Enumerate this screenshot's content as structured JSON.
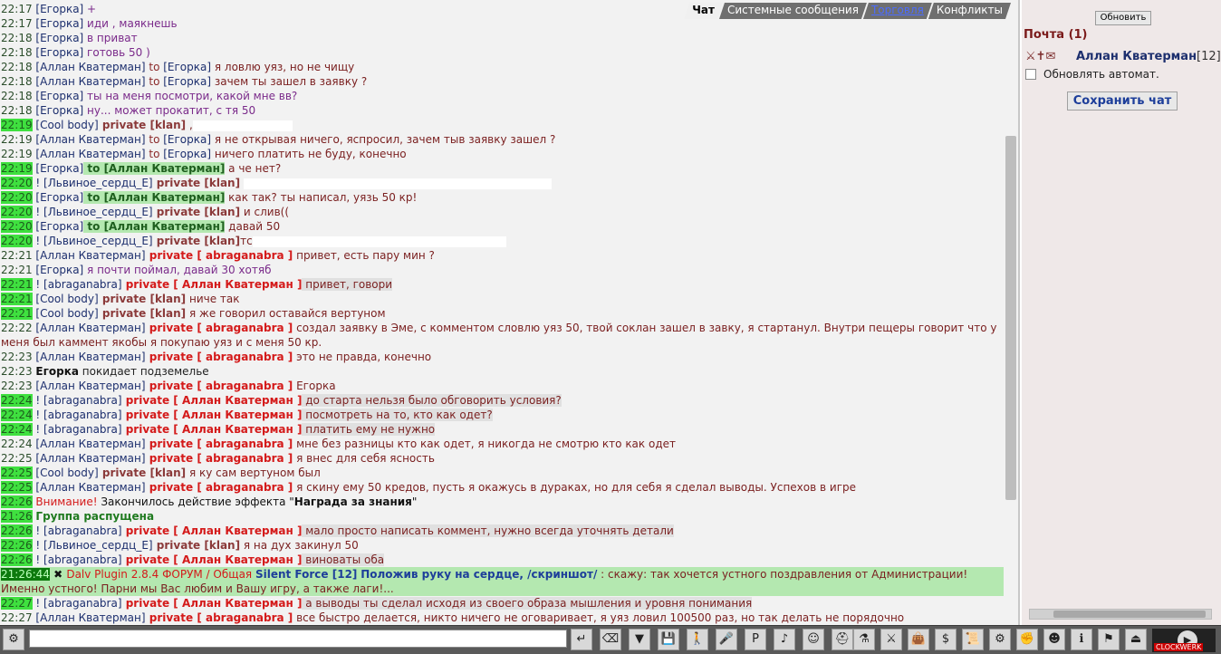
{
  "tabs": [
    {
      "label": "Чат"
    },
    {
      "label": "Системные сообщения"
    },
    {
      "label": "Торговля"
    },
    {
      "label": "Конфликты"
    }
  ],
  "sidebar": {
    "refresh_label": "Обновить",
    "mail_title": "Почта (1)",
    "mail_user": "Аллан Кватерман",
    "mail_level": "[12]",
    "auto_refresh_label": "Обновлять автомат.",
    "save_chat_label": "Сохранить чат"
  },
  "messages": [
    {
      "ts": "22:17",
      "nick": "[Егорка]",
      "text": " +",
      "style": "purple"
    },
    {
      "ts": "22:17",
      "nick": "[Егорка]",
      "text": " иди , маякнешь",
      "style": "purple"
    },
    {
      "ts": "22:18",
      "nick": "[Егорка]",
      "text": " в приват",
      "style": "purple"
    },
    {
      "ts": "22:18",
      "nick": "[Егорка]",
      "text": " готовь 50 )",
      "style": "purple"
    },
    {
      "ts": "22:18",
      "nick": "[Аллан Кватерман]",
      "to": " to ",
      "tonick": "[Егорка]",
      "text": " я ловлю уяз, но не чищу"
    },
    {
      "ts": "22:18",
      "nick": "[Аллан Кватерман]",
      "to": " to ",
      "tonick": "[Егорка]",
      "text": " зачем ты зашел в заявку ?"
    },
    {
      "ts": "22:18",
      "nick": "[Егорка]",
      "text": " ты на меня посмотри, какой мне вв?",
      "style": "purple"
    },
    {
      "ts": "22:18",
      "nick": "[Егорка]",
      "text": " ну... может прокатит, с тя 50",
      "style": "purple"
    }
  ],
  "messages2": [
    {
      "ts": "22:19",
      "nick": "[Cool body]",
      "priv": " private [klan]",
      "text": " ,"
    },
    {
      "ts": "22:19",
      "nick": "[Аллан Кватерман]",
      "to": " to ",
      "tonick": "[Егорка]",
      "text": " я не открывая ничего, яспросил, зачем тыв заявку зашел ?"
    },
    {
      "ts": "22:19",
      "nick": "[Аллан Кватерман]",
      "to": " to ",
      "tonick": "[Егорка]",
      "text": " ничего платить не буду, конечно"
    },
    {
      "ts": "22:19",
      "nick": "[Егорка]",
      "togreen": " to [Аллан Кватерман]",
      "text": " а че нет?"
    },
    {
      "ts": "22:20",
      "nick": "! [Львиное_сердц_Е]",
      "priv": " private [klan]",
      "text": " "
    },
    {
      "ts": "22:20",
      "nick": "[Егорка]",
      "togreen": " to [Аллан Кватерман]",
      "text": " как так? ты написал, уязь 50 кр!"
    },
    {
      "ts": "22:20",
      "nick": "! [Львиное_сердц_Е]",
      "priv": " private [klan]",
      "text": " и слив(("
    },
    {
      "ts": "22:20",
      "nick": "[Егорка]",
      "togreen": " to [Аллан Кватерман]",
      "text": " давай 50"
    },
    {
      "ts": "22:20",
      "nick": "! [Львиное_сердц_Е]",
      "priv": " private [klan]",
      "text": "тс"
    },
    {
      "ts": "22:21",
      "nick": "[Аллан Кватерман]",
      "privred": " private [ abraganabra ]",
      "text": " привет, есть пару мин ?"
    },
    {
      "ts": "22:21",
      "nick": "[Егорка]",
      "text": " я почти поймал, давай 30 хотяб",
      "style": "purple"
    },
    {
      "ts": "22:21",
      "nick": "! [abraganabra]",
      "privred": " private [ Аллан Кватерман ]",
      "text": " привет, говори"
    },
    {
      "ts": "22:21",
      "nick": "[Cool body]",
      "priv": " private [klan]",
      "text": " ниче так"
    },
    {
      "ts": "22:21",
      "nick": "[Cool body]",
      "priv": " private [klan]",
      "text": " я же говорил оставайся вертуном"
    }
  ],
  "long_msg": {
    "ts": "22:22",
    "nick": "[Аллан Кватерман]",
    "priv": " private [ abraganabra ]",
    "text": " создал заявку в Эме, с комментом словлю уяз 50, твой соклан зашел в завку, я стартанул. Внутри пещеры говорит что у меня был каммент якобы я покупаю уяз и с меня 50 кр."
  },
  "messages3": [
    {
      "ts": "22:23",
      "nick": "[Аллан Кватерман]",
      "privred": " private [ abraganabra ]",
      "text": " это не правда, конечно"
    },
    {
      "ts": "22:23",
      "nick": "Егорка",
      "text": " покидает подземелье",
      "style": "system"
    },
    {
      "ts": "22:23",
      "nick": "[Аллан Кватерман]",
      "privred": " private [ abraganabra ]",
      "text": " Егорка"
    },
    {
      "ts": "22:24",
      "nick": "! [abraganabra]",
      "privred": " private [ Аллан Кватерман ]",
      "text": " до старта нельзя было обговорить условия?"
    },
    {
      "ts": "22:24",
      "nick": "! [abraganabra]",
      "privred": " private [ Аллан Кватерман ]",
      "text": " посмотреть на то, кто как одет?"
    },
    {
      "ts": "22:24",
      "nick": "! [abraganabra]",
      "privred": " private [ Аллан Кватерман ]",
      "text": " платить ему не нужно"
    },
    {
      "ts": "22:24",
      "nick": "[Аллан Кватерман]",
      "privred": " private [ abraganabra ]",
      "text": " мне без разницы кто как одет, я никогда не смотрю кто как одет"
    },
    {
      "ts": "22:25",
      "nick": "[Аллан Кватерман]",
      "privred": " private [ abraganabra ]",
      "text": " я внес для себя ясность"
    },
    {
      "ts": "22:25",
      "nick": "[Cool body]",
      "priv": " private [klan]",
      "text": " я ку сам вертуном был"
    },
    {
      "ts": "22:25",
      "nick": "[Аллан Кватерман]",
      "privred": " private [ abraganabra ]",
      "text": " я скину ему 50 кредов, пусть я окажусь в дураках, но для себя я сделал выводы. Успехов в игре"
    }
  ],
  "warning": {
    "ts": "22:26",
    "label": "Внимание!",
    "text": " Закончилось действие эффекта \"",
    "effect": "Награда за знания",
    "end": "\""
  },
  "group": {
    "ts": "21:26",
    "text": "Группа распущена"
  },
  "messages4": [
    {
      "ts": "22:26",
      "nick": "! [abraganabra]",
      "privred": " private [ Аллан Кватерман ]",
      "text": " мало просто написать коммент, нужно всегда уточнять детали"
    },
    {
      "ts": "22:26",
      "nick": "! [Львиное_сердц_Е]",
      "priv": " private [klan]",
      "text": " я на дух закинул 50"
    },
    {
      "ts": "22:26",
      "nick": "! [abraganabra]",
      "privred": " private [ Аллан Кватерман ]",
      "text": " виноваты оба"
    }
  ],
  "plugin": {
    "ts": "21:26:44",
    "title": "Dalv Plugin 2.8.4 ФОРУМ / Общая",
    "sf": "Silent Force [12]",
    "act": "Положив руку на сердце,  /скриншот/",
    "text": " : скажу: так хочется устного поздравления от Администрации! Именно устного! Парни мы Вас любим и Вашу игру, а также лаги!..."
  },
  "messages5": [
    {
      "ts": "22:27",
      "nick": "! [abraganabra]",
      "privred": " private [ Аллан Кватерман ]",
      "text": " а выводы ты сделал исходя из своего образа мышления и уровня понимания"
    },
    {
      "ts": "22:27",
      "nick": "[Аллан Кватерман]",
      "privred": " private [ abraganabra ]",
      "text": " все быстро делается, никто ничего не оговаривает, я уяз ловил 100500 раз, но так делать не порядочно"
    }
  ],
  "toolbar": {
    "buttons": [
      "enter-icon",
      "eraser-icon",
      "filter-icon",
      "save-icon",
      "walk-icon",
      "mic-icon",
      "private-icon",
      "sound-icon",
      "smile-icon",
      "helmet-icon"
    ],
    "right_buttons": [
      "flask-icon",
      "fight-icon",
      "bag-icon",
      "cash-icon",
      "scroll-icon",
      "gear-icon",
      "fist-icon",
      "friends-icon",
      "info-icon",
      "flag-icon",
      "exit-icon"
    ],
    "clock_label": "CLOCKWERK"
  }
}
